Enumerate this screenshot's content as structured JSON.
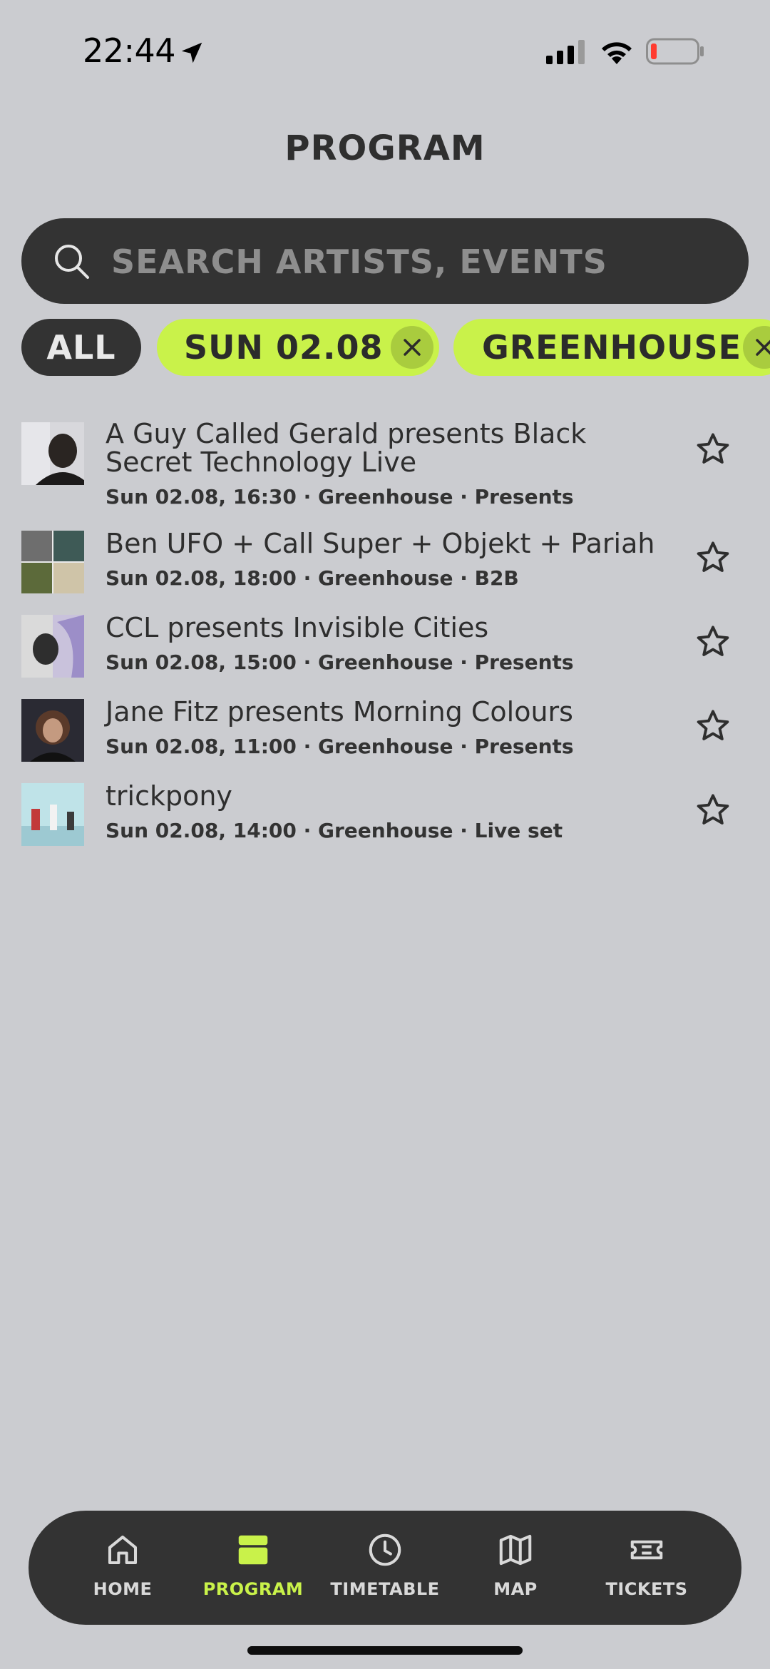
{
  "status_bar": {
    "time": "22:44"
  },
  "header": {
    "title": "PROGRAM"
  },
  "search": {
    "placeholder": "SEARCH ARTISTS, EVENTS"
  },
  "filters": {
    "all_label": "ALL",
    "date_label": "SUN 02.08",
    "venue_label": "GREENHOUSE"
  },
  "events": [
    {
      "title": "A Guy Called Gerald presents Black Secret Technology Live",
      "date": "Sun 02.08, 16:30",
      "venue": "Greenhouse",
      "type": "Presents"
    },
    {
      "title": "Ben UFO + Call Super + Objekt + Pariah",
      "date": "Sun 02.08, 18:00",
      "venue": "Greenhouse",
      "type": "B2B"
    },
    {
      "title": "CCL presents Invisible Cities",
      "date": "Sun 02.08, 15:00",
      "venue": "Greenhouse",
      "type": "Presents"
    },
    {
      "title": "Jane Fitz presents Morning Colours",
      "date": "Sun 02.08, 11:00",
      "venue": "Greenhouse",
      "type": "Presents"
    },
    {
      "title": "trickpony",
      "date": "Sun 02.08, 14:00",
      "venue": "Greenhouse",
      "type": "Live set"
    }
  ],
  "meta_separator": "·",
  "nav": {
    "items": [
      {
        "label": "HOME",
        "icon": "home-icon"
      },
      {
        "label": "PROGRAM",
        "icon": "program-icon",
        "active": true
      },
      {
        "label": "TIMETABLE",
        "icon": "clock-icon"
      },
      {
        "label": "MAP",
        "icon": "map-icon"
      },
      {
        "label": "TICKETS",
        "icon": "ticket-icon"
      }
    ]
  },
  "colors": {
    "background": "#CBCCD0",
    "dark": "#333333",
    "accent": "#C9F24A",
    "battery_low": "#FF3B30"
  }
}
